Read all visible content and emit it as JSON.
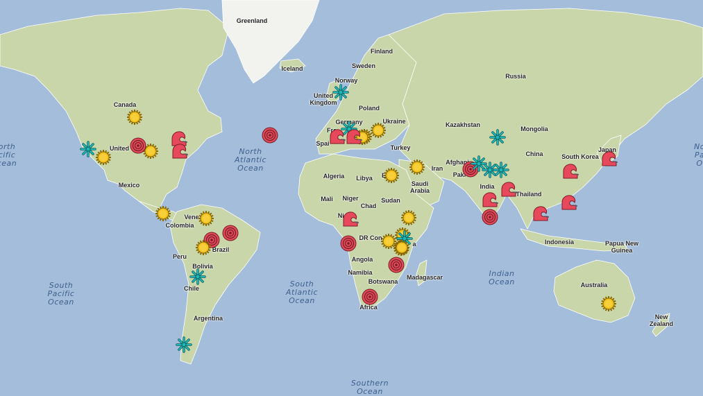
{
  "map": {
    "countries": [
      {
        "id": "greenland",
        "label": "Greenland"
      },
      {
        "id": "iceland",
        "label": "Iceland"
      },
      {
        "id": "finland",
        "label": "Finland"
      },
      {
        "id": "sweden",
        "label": "Sweden"
      },
      {
        "id": "norway",
        "label": "Norway"
      },
      {
        "id": "uk",
        "label": "United\nKingdom"
      },
      {
        "id": "russia",
        "label": "Russia"
      },
      {
        "id": "poland",
        "label": "Poland"
      },
      {
        "id": "germany",
        "label": "Germany"
      },
      {
        "id": "ukraine",
        "label": "Ukraine"
      },
      {
        "id": "france",
        "label": "Fra"
      },
      {
        "id": "spain",
        "label": "Spai"
      },
      {
        "id": "turkey",
        "label": "Turkey"
      },
      {
        "id": "kazakhstan",
        "label": "Kazakhstan"
      },
      {
        "id": "mongolia",
        "label": "Mongolia"
      },
      {
        "id": "china",
        "label": "China"
      },
      {
        "id": "south-korea",
        "label": "South Korea"
      },
      {
        "id": "japan",
        "label": "Japan"
      },
      {
        "id": "afghanistan",
        "label": "Afghani"
      },
      {
        "id": "pakistan",
        "label": "Paki"
      },
      {
        "id": "iran",
        "label": "Iran"
      },
      {
        "id": "saudi-arabia",
        "label": "Saudi\nArabia"
      },
      {
        "id": "india",
        "label": "India"
      },
      {
        "id": "thailand",
        "label": "Thailand"
      },
      {
        "id": "indonesia",
        "label": "Indonesia"
      },
      {
        "id": "papua-new-guinea",
        "label": "Papua New\nGuinea"
      },
      {
        "id": "australia",
        "label": "Australia"
      },
      {
        "id": "new-zealand",
        "label": "New\nZealand"
      },
      {
        "id": "canada",
        "label": "Canada"
      },
      {
        "id": "united-states",
        "label": "United"
      },
      {
        "id": "mexico",
        "label": "Mexico"
      },
      {
        "id": "venezuela",
        "label": "Vene"
      },
      {
        "id": "colombia",
        "label": "Colombia"
      },
      {
        "id": "peru",
        "label": "Peru"
      },
      {
        "id": "brazil",
        "label": "Brazil"
      },
      {
        "id": "bolivia",
        "label": "Bolivia"
      },
      {
        "id": "chile",
        "label": "Chile"
      },
      {
        "id": "argentina",
        "label": "Argentina"
      },
      {
        "id": "algeria",
        "label": "Algeria"
      },
      {
        "id": "libya",
        "label": "Libya"
      },
      {
        "id": "egypt",
        "label": "E"
      },
      {
        "id": "mali",
        "label": "Mali"
      },
      {
        "id": "niger",
        "label": "Niger"
      },
      {
        "id": "chad",
        "label": "Chad"
      },
      {
        "id": "sudan",
        "label": "Sudan"
      },
      {
        "id": "nigeria",
        "label": "Nig"
      },
      {
        "id": "dr-congo",
        "label": "DR Con"
      },
      {
        "id": "kenya",
        "label": "a"
      },
      {
        "id": "angola",
        "label": "Angola"
      },
      {
        "id": "namibia",
        "label": "Namibia"
      },
      {
        "id": "botswana",
        "label": "Botswana"
      },
      {
        "id": "madagascar",
        "label": "Madagascar"
      },
      {
        "id": "south-africa",
        "label": "Africa"
      }
    ],
    "oceans": [
      {
        "id": "north-atlantic",
        "label": "North\nAtlantic\nOcean"
      },
      {
        "id": "south-atlantic",
        "label": "South\nAtlantic\nOcean"
      },
      {
        "id": "south-pacific",
        "label": "South\nPacific\nOcean"
      },
      {
        "id": "north-pacific-partial",
        "label": "orth\ncific\ncean"
      },
      {
        "id": "north-pacific-partial-right",
        "label": "No\nPa\nO"
      },
      {
        "id": "indian",
        "label": "Indian\nOcean"
      },
      {
        "id": "southern",
        "label": "Southern\nOcean"
      }
    ],
    "legend_types": {
      "sun": {
        "icon": "sun-icon",
        "color": "#f2c11b"
      },
      "target": {
        "icon": "target-icon",
        "color": "#e04b5a"
      },
      "wave": {
        "icon": "wave-icon",
        "color": "#e8485c"
      },
      "snow": {
        "icon": "snowflake-icon",
        "color": "#1fb7b7"
      }
    },
    "markers": [
      {
        "type": "sun",
        "region": "canada"
      },
      {
        "type": "sun",
        "region": "united-states-west"
      },
      {
        "type": "sun",
        "region": "united-states-central"
      },
      {
        "type": "target",
        "region": "united-states-central"
      },
      {
        "type": "wave",
        "region": "united-states-east-1"
      },
      {
        "type": "wave",
        "region": "united-states-east-2"
      },
      {
        "type": "snow",
        "region": "united-states-west-coast"
      },
      {
        "type": "target",
        "region": "north-atlantic"
      },
      {
        "type": "snow",
        "region": "uk"
      },
      {
        "type": "snow",
        "region": "germany"
      },
      {
        "type": "sun",
        "region": "ukraine"
      },
      {
        "type": "sun",
        "region": "balkans"
      },
      {
        "type": "sun",
        "region": "italy"
      },
      {
        "type": "wave",
        "region": "france"
      },
      {
        "type": "wave",
        "region": "italy"
      },
      {
        "type": "sun",
        "region": "egypt"
      },
      {
        "type": "sun",
        "region": "iran"
      },
      {
        "type": "snow",
        "region": "china-west"
      },
      {
        "type": "target",
        "region": "pakistan"
      },
      {
        "type": "snow",
        "region": "himalaya-1"
      },
      {
        "type": "snow",
        "region": "himalaya-2"
      },
      {
        "type": "snow",
        "region": "himalaya-3"
      },
      {
        "type": "wave",
        "region": "south-korea"
      },
      {
        "type": "wave",
        "region": "japan"
      },
      {
        "type": "wave",
        "region": "india-west"
      },
      {
        "type": "wave",
        "region": "bangladesh"
      },
      {
        "type": "target",
        "region": "india-south"
      },
      {
        "type": "wave",
        "region": "myanmar"
      },
      {
        "type": "wave",
        "region": "philippines"
      },
      {
        "type": "sun",
        "region": "venezuela"
      },
      {
        "type": "sun",
        "region": "colombia"
      },
      {
        "type": "target",
        "region": "brazil-north"
      },
      {
        "type": "target",
        "region": "brazil-west"
      },
      {
        "type": "sun",
        "region": "brazil-west"
      },
      {
        "type": "snow",
        "region": "chile"
      },
      {
        "type": "snow",
        "region": "patagonia"
      },
      {
        "type": "wave",
        "region": "nigeria"
      },
      {
        "type": "target",
        "region": "gabon"
      },
      {
        "type": "sun",
        "region": "somalia"
      },
      {
        "type": "sun",
        "region": "kenya-1"
      },
      {
        "type": "snow",
        "region": "kenya"
      },
      {
        "type": "sun",
        "region": "kenya-2"
      },
      {
        "type": "sun",
        "region": "congo-east"
      },
      {
        "type": "sun",
        "region": "tanzania"
      },
      {
        "type": "target",
        "region": "mozambique"
      },
      {
        "type": "target",
        "region": "south-africa"
      },
      {
        "type": "sun",
        "region": "australia"
      }
    ]
  }
}
